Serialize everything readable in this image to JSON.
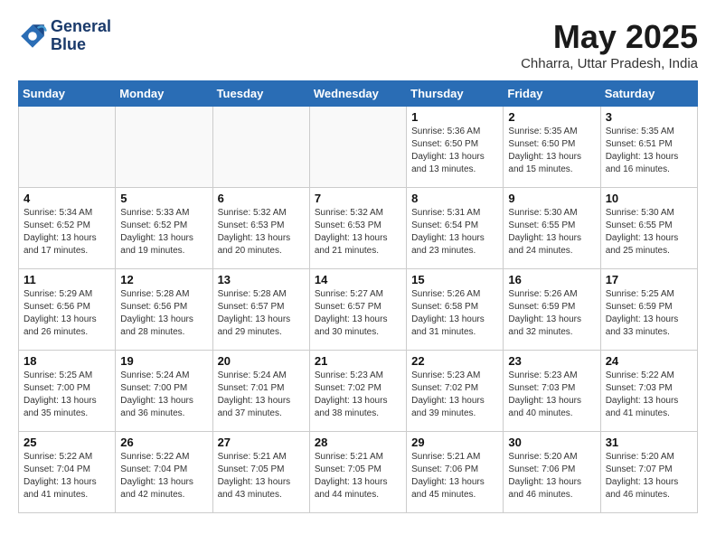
{
  "header": {
    "logo_line1": "General",
    "logo_line2": "Blue",
    "month_title": "May 2025",
    "location": "Chharra, Uttar Pradesh, India"
  },
  "days_of_week": [
    "Sunday",
    "Monday",
    "Tuesday",
    "Wednesday",
    "Thursday",
    "Friday",
    "Saturday"
  ],
  "weeks": [
    [
      {
        "num": "",
        "info": ""
      },
      {
        "num": "",
        "info": ""
      },
      {
        "num": "",
        "info": ""
      },
      {
        "num": "",
        "info": ""
      },
      {
        "num": "1",
        "info": "Sunrise: 5:36 AM\nSunset: 6:50 PM\nDaylight: 13 hours\nand 13 minutes."
      },
      {
        "num": "2",
        "info": "Sunrise: 5:35 AM\nSunset: 6:50 PM\nDaylight: 13 hours\nand 15 minutes."
      },
      {
        "num": "3",
        "info": "Sunrise: 5:35 AM\nSunset: 6:51 PM\nDaylight: 13 hours\nand 16 minutes."
      }
    ],
    [
      {
        "num": "4",
        "info": "Sunrise: 5:34 AM\nSunset: 6:52 PM\nDaylight: 13 hours\nand 17 minutes."
      },
      {
        "num": "5",
        "info": "Sunrise: 5:33 AM\nSunset: 6:52 PM\nDaylight: 13 hours\nand 19 minutes."
      },
      {
        "num": "6",
        "info": "Sunrise: 5:32 AM\nSunset: 6:53 PM\nDaylight: 13 hours\nand 20 minutes."
      },
      {
        "num": "7",
        "info": "Sunrise: 5:32 AM\nSunset: 6:53 PM\nDaylight: 13 hours\nand 21 minutes."
      },
      {
        "num": "8",
        "info": "Sunrise: 5:31 AM\nSunset: 6:54 PM\nDaylight: 13 hours\nand 23 minutes."
      },
      {
        "num": "9",
        "info": "Sunrise: 5:30 AM\nSunset: 6:55 PM\nDaylight: 13 hours\nand 24 minutes."
      },
      {
        "num": "10",
        "info": "Sunrise: 5:30 AM\nSunset: 6:55 PM\nDaylight: 13 hours\nand 25 minutes."
      }
    ],
    [
      {
        "num": "11",
        "info": "Sunrise: 5:29 AM\nSunset: 6:56 PM\nDaylight: 13 hours\nand 26 minutes."
      },
      {
        "num": "12",
        "info": "Sunrise: 5:28 AM\nSunset: 6:56 PM\nDaylight: 13 hours\nand 28 minutes."
      },
      {
        "num": "13",
        "info": "Sunrise: 5:28 AM\nSunset: 6:57 PM\nDaylight: 13 hours\nand 29 minutes."
      },
      {
        "num": "14",
        "info": "Sunrise: 5:27 AM\nSunset: 6:57 PM\nDaylight: 13 hours\nand 30 minutes."
      },
      {
        "num": "15",
        "info": "Sunrise: 5:26 AM\nSunset: 6:58 PM\nDaylight: 13 hours\nand 31 minutes."
      },
      {
        "num": "16",
        "info": "Sunrise: 5:26 AM\nSunset: 6:59 PM\nDaylight: 13 hours\nand 32 minutes."
      },
      {
        "num": "17",
        "info": "Sunrise: 5:25 AM\nSunset: 6:59 PM\nDaylight: 13 hours\nand 33 minutes."
      }
    ],
    [
      {
        "num": "18",
        "info": "Sunrise: 5:25 AM\nSunset: 7:00 PM\nDaylight: 13 hours\nand 35 minutes."
      },
      {
        "num": "19",
        "info": "Sunrise: 5:24 AM\nSunset: 7:00 PM\nDaylight: 13 hours\nand 36 minutes."
      },
      {
        "num": "20",
        "info": "Sunrise: 5:24 AM\nSunset: 7:01 PM\nDaylight: 13 hours\nand 37 minutes."
      },
      {
        "num": "21",
        "info": "Sunrise: 5:23 AM\nSunset: 7:02 PM\nDaylight: 13 hours\nand 38 minutes."
      },
      {
        "num": "22",
        "info": "Sunrise: 5:23 AM\nSunset: 7:02 PM\nDaylight: 13 hours\nand 39 minutes."
      },
      {
        "num": "23",
        "info": "Sunrise: 5:23 AM\nSunset: 7:03 PM\nDaylight: 13 hours\nand 40 minutes."
      },
      {
        "num": "24",
        "info": "Sunrise: 5:22 AM\nSunset: 7:03 PM\nDaylight: 13 hours\nand 41 minutes."
      }
    ],
    [
      {
        "num": "25",
        "info": "Sunrise: 5:22 AM\nSunset: 7:04 PM\nDaylight: 13 hours\nand 41 minutes."
      },
      {
        "num": "26",
        "info": "Sunrise: 5:22 AM\nSunset: 7:04 PM\nDaylight: 13 hours\nand 42 minutes."
      },
      {
        "num": "27",
        "info": "Sunrise: 5:21 AM\nSunset: 7:05 PM\nDaylight: 13 hours\nand 43 minutes."
      },
      {
        "num": "28",
        "info": "Sunrise: 5:21 AM\nSunset: 7:05 PM\nDaylight: 13 hours\nand 44 minutes."
      },
      {
        "num": "29",
        "info": "Sunrise: 5:21 AM\nSunset: 7:06 PM\nDaylight: 13 hours\nand 45 minutes."
      },
      {
        "num": "30",
        "info": "Sunrise: 5:20 AM\nSunset: 7:06 PM\nDaylight: 13 hours\nand 46 minutes."
      },
      {
        "num": "31",
        "info": "Sunrise: 5:20 AM\nSunset: 7:07 PM\nDaylight: 13 hours\nand 46 minutes."
      }
    ]
  ]
}
